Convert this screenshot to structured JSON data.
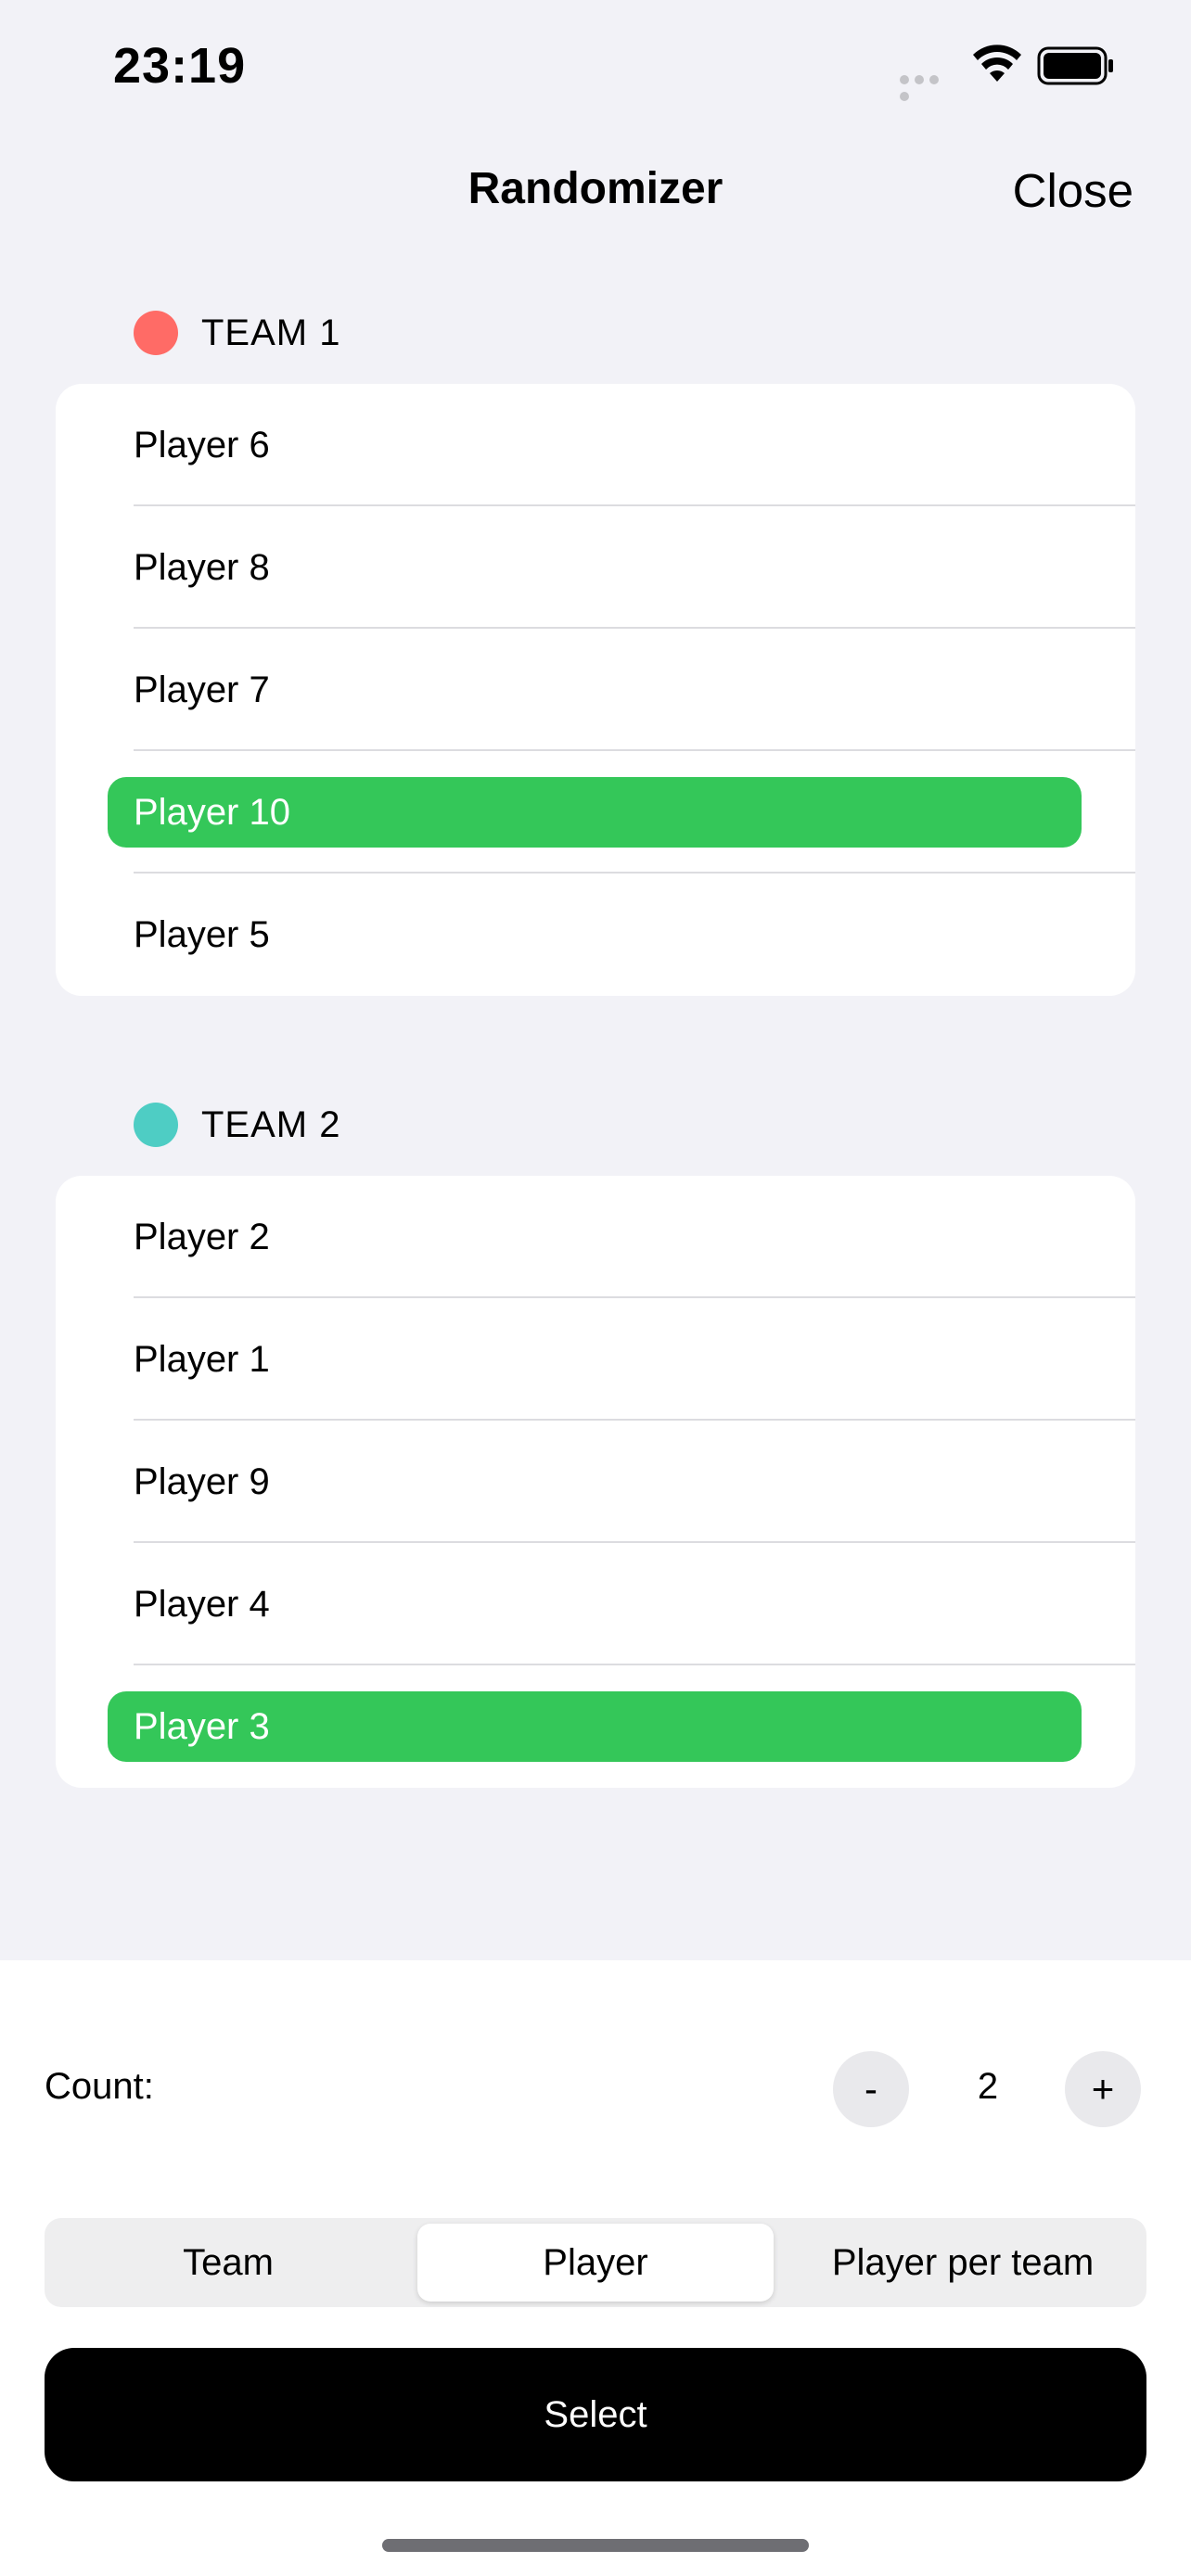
{
  "status_bar": {
    "time": "23:19"
  },
  "nav": {
    "title": "Randomizer",
    "close_label": "Close"
  },
  "teams": [
    {
      "name": "TEAM 1",
      "color": "#ff6b66",
      "players": [
        {
          "name": "Player 6",
          "selected": false
        },
        {
          "name": "Player 8",
          "selected": false
        },
        {
          "name": "Player 7",
          "selected": false
        },
        {
          "name": "Player 10",
          "selected": true
        },
        {
          "name": "Player 5",
          "selected": false
        }
      ]
    },
    {
      "name": "TEAM 2",
      "color": "#4ecdc4",
      "players": [
        {
          "name": "Player 2",
          "selected": false
        },
        {
          "name": "Player 1",
          "selected": false
        },
        {
          "name": "Player 9",
          "selected": false
        },
        {
          "name": "Player 4",
          "selected": false
        },
        {
          "name": "Player 3",
          "selected": true
        }
      ]
    }
  ],
  "selected_color": "#34c759",
  "controls": {
    "count_label": "Count:",
    "count_value": "2",
    "minus_label": "-",
    "plus_label": "+",
    "segments": [
      "Team",
      "Player",
      "Player per team"
    ],
    "active_segment": "Player",
    "select_label": "Select"
  }
}
